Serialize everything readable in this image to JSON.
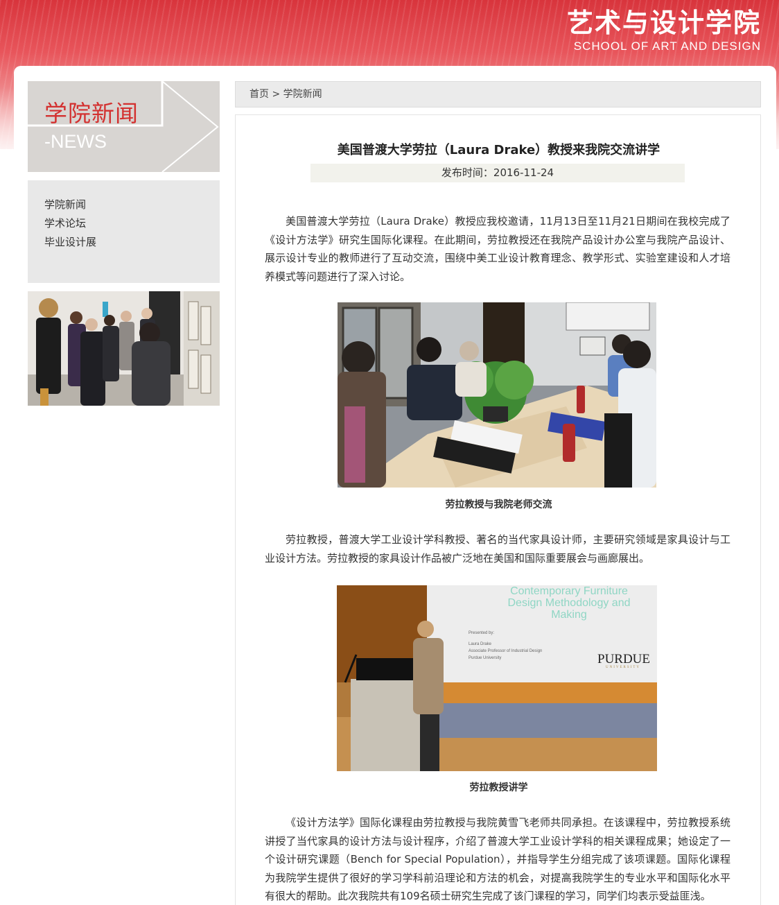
{
  "header": {
    "school_name_cn": "艺术与设计学院",
    "school_name_en": "SCHOOL OF ART AND DESIGN"
  },
  "sidebar": {
    "title_cn": "学院新闻",
    "title_en": "-NEWS",
    "items": [
      {
        "label": "学院新闻"
      },
      {
        "label": "学术论坛"
      },
      {
        "label": "毕业设计展"
      }
    ]
  },
  "breadcrumb": {
    "home": "首页",
    "separator": ">",
    "current": "学院新闻"
  },
  "article": {
    "title": "美国普渡大学劳拉（Laura Drake）教授来我院交流讲学",
    "publish_time": "发布时间：2016-11-24",
    "paragraph_1": "美国普渡大学劳拉（Laura Drake）教授应我校邀请，11月13日至11月21日期间在我校完成了《设计方法学》研究生国际化课程。在此期间，劳拉教授还在我院产品设计办公室与我院产品设计、展示设计专业的教师进行了互动交流，围绕中美工业设计教育理念、教学形式、实验室建设和人才培养模式等问题进行了深入讨论。",
    "caption_1": "劳拉教授与我院老师交流",
    "paragraph_2": "劳拉教授，普渡大学工业设计学科教授、著名的当代家具设计师，主要研究领域是家具设计与工业设计方法。劳拉教授的家具设计作品被广泛地在美国和国际重要展会与画廊展出。",
    "slide": {
      "title_line1": "Contemporary Furniture",
      "title_line2": "Design Methodology and",
      "title_line3": "Making",
      "presented_by": "Presented by:",
      "presenter": "Laura Drake",
      "role": "Associate Professor of Industrial Design",
      "org": "Purdue University",
      "logo": "PURDUE",
      "logo_sub": "UNIVERSITY"
    },
    "caption_2": "劳拉教授讲学",
    "paragraph_3": "《设计方法学》国际化课程由劳拉教授与我院黄雪飞老师共同承担。在该课程中，劳拉教授系统讲授了当代家具的设计方法与设计程序，介绍了普渡大学工业设计学科的相关课程成果；她设定了一个设计研究课题（Bench for Special Population），并指导学生分组完成了该项课题。国际化课程为我院学生提供了很好的学习学科前沿理论和方法的机会，对提高我院学生的专业水平和国际化水平有很大的帮助。此次我院共有109名硕士研究生完成了该门课程的学习，同学们均表示受益匪浅。"
  },
  "colors": {
    "brand_red": "#d3302f",
    "sidebar_gray": "#d8d5d2",
    "menu_gray": "#e8e8e8"
  }
}
